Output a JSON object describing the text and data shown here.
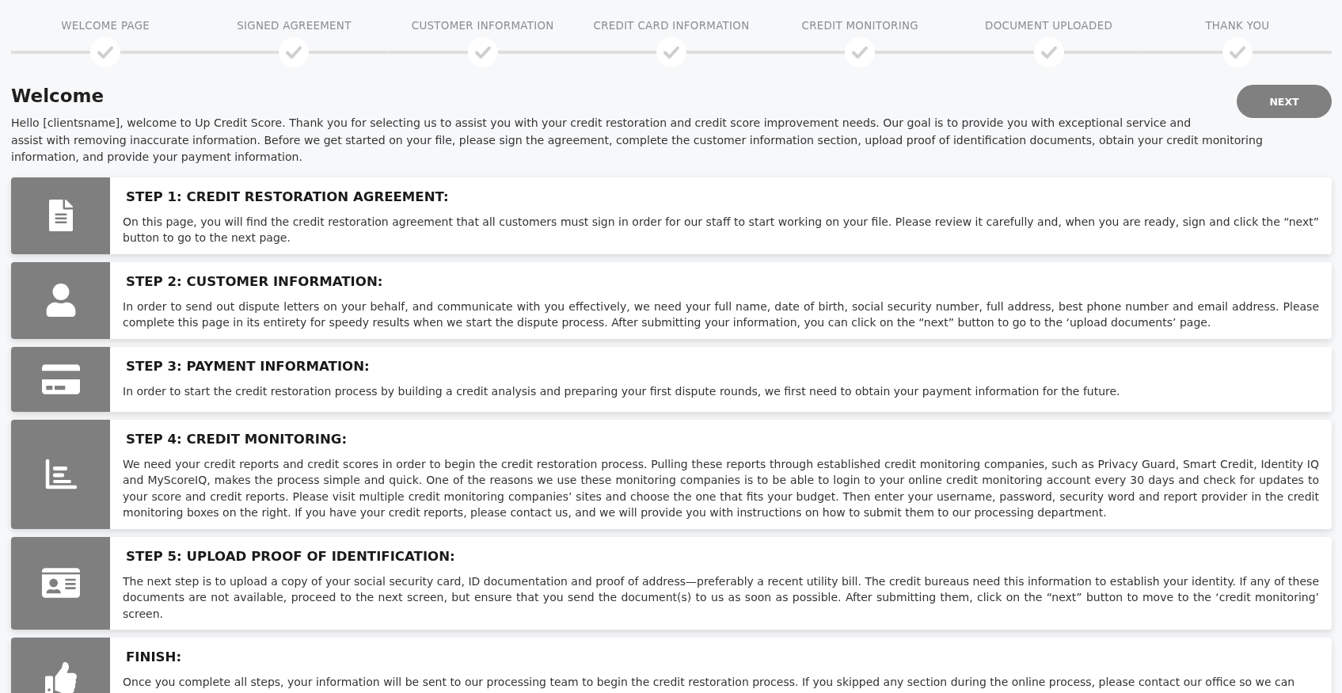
{
  "stepper": {
    "steps": [
      "WELCOME PAGE",
      "SIGNED AGREEMENT",
      "CUSTOMER INFORMATION",
      "CREDIT CARD INFORMATION",
      "CREDIT MONITORING",
      "DOCUMENT UPLOADED",
      "THANK YOU"
    ]
  },
  "header": {
    "title": "Welcome",
    "intro": "Hello [clientsname], welcome to Up Credit Score. Thank you for selecting us to assist you with your credit restoration and credit score improvement needs. Our goal is to provide you with exceptional service and assist with removing inaccurate information. Before we get started on your file, please sign the agreement, complete the customer information section, upload proof of identification documents, obtain your credit monitoring information, and provide your payment information.",
    "next_button": "NEXT"
  },
  "cards": [
    {
      "title": "STEP 1: CREDIT RESTORATION AGREEMENT:",
      "body": "On this page, you will find the credit restoration agreement that all customers must sign in order for our staff to start working on your file. Please review it carefully and, when you are ready, sign and click the “next” button to go to the next page."
    },
    {
      "title": "STEP 2: CUSTOMER INFORMATION:",
      "body": "In order to send out dispute letters on your behalf, and communicate with you effectively, we need your full name, date of birth, social security number, full address, best phone number and email address. Please complete this page in its entirety for speedy results when we start the dispute process. After submitting your information, you can click on the “next” button to go to the ‘upload documents’ page."
    },
    {
      "title": "STEP 3: PAYMENT INFORMATION:",
      "body": "In order to start the credit restoration process by building a credit analysis and preparing your first dispute rounds, we first need to obtain your payment information for the future."
    },
    {
      "title": "STEP 4: CREDIT MONITORING:",
      "body": "We need your credit reports and credit scores in order to begin the credit restoration process. Pulling these reports through established credit monitoring companies, such as Privacy Guard, Smart Credit, Identity IQ and MyScoreIQ, makes the process simple and quick. One of the reasons we use these monitoring companies is to be able to login to your online credit monitoring account every 30 days and check for updates to your score and credit reports. Please visit multiple credit monitoring companies’ sites and choose the one that fits your budget. Then enter your username, password, security word and report provider in the credit monitoring boxes on the right. If you have your credit reports, please contact us, and we will provide you with instructions on how to submit them to our processing department."
    },
    {
      "title": "STEP 5: UPLOAD PROOF OF IDENTIFICATION:",
      "body": "The next step is to upload a copy of your social security card, ID documentation and proof of address—preferably a recent utility bill. The credit bureaus need this information to establish your identity. If any of these documents are not available, proceed to the next screen, but ensure that you send the document(s) to us as soon as possible. After submitting them, click on the “next” button to move to the ‘credit monitoring’ screen."
    },
    {
      "title": "FINISH:",
      "body": "Once you complete all steps, your information will be sent to our processing team to begin the credit restoration process. If you skipped any section during the online process, please contact our office so we can"
    }
  ]
}
